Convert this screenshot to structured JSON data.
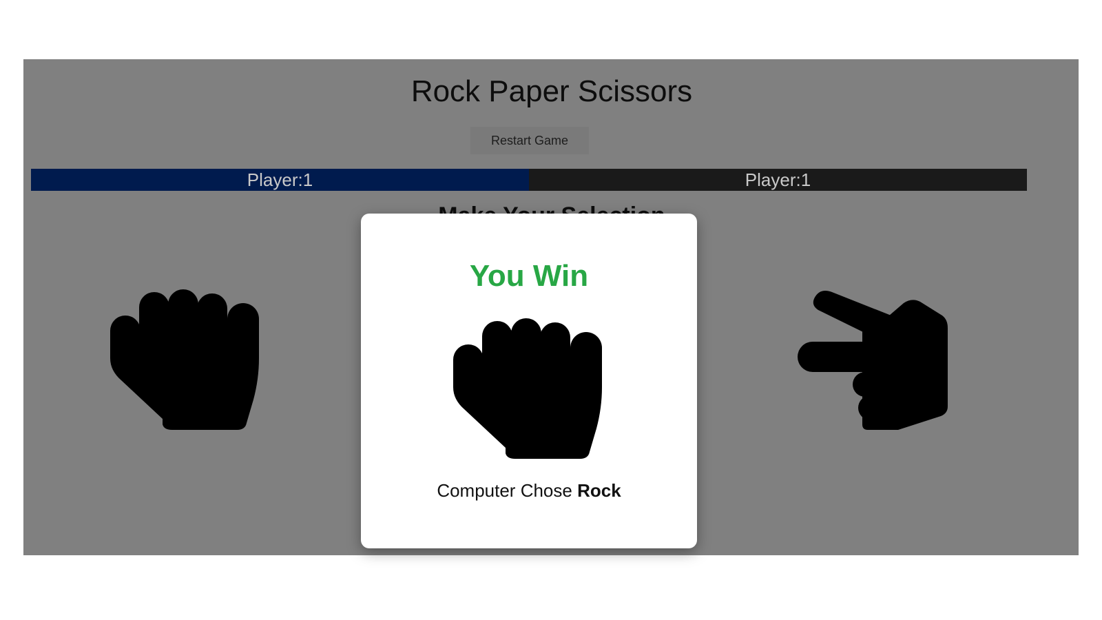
{
  "app": {
    "title": "Rock Paper Scissors",
    "restart_label": "Restart Game",
    "prompt": "Make Your Selection"
  },
  "scoreboard": {
    "player_label": "Player:1",
    "computer_label": "Player:1",
    "player_color": "#001b4e",
    "computer_color": "#1a1a1a"
  },
  "choices": [
    {
      "name": "rock",
      "icon": "rock-fist-icon"
    },
    {
      "name": "scissors",
      "icon": "scissors-hand-icon"
    }
  ],
  "modal": {
    "result": "You Win",
    "result_color": "#28a745",
    "computer_choice_prefix": "Computer Chose",
    "computer_choice": "Rock",
    "icon": "rock-fist-icon"
  },
  "colors": {
    "overlay": "#808080",
    "modal_bg": "#ffffff"
  }
}
